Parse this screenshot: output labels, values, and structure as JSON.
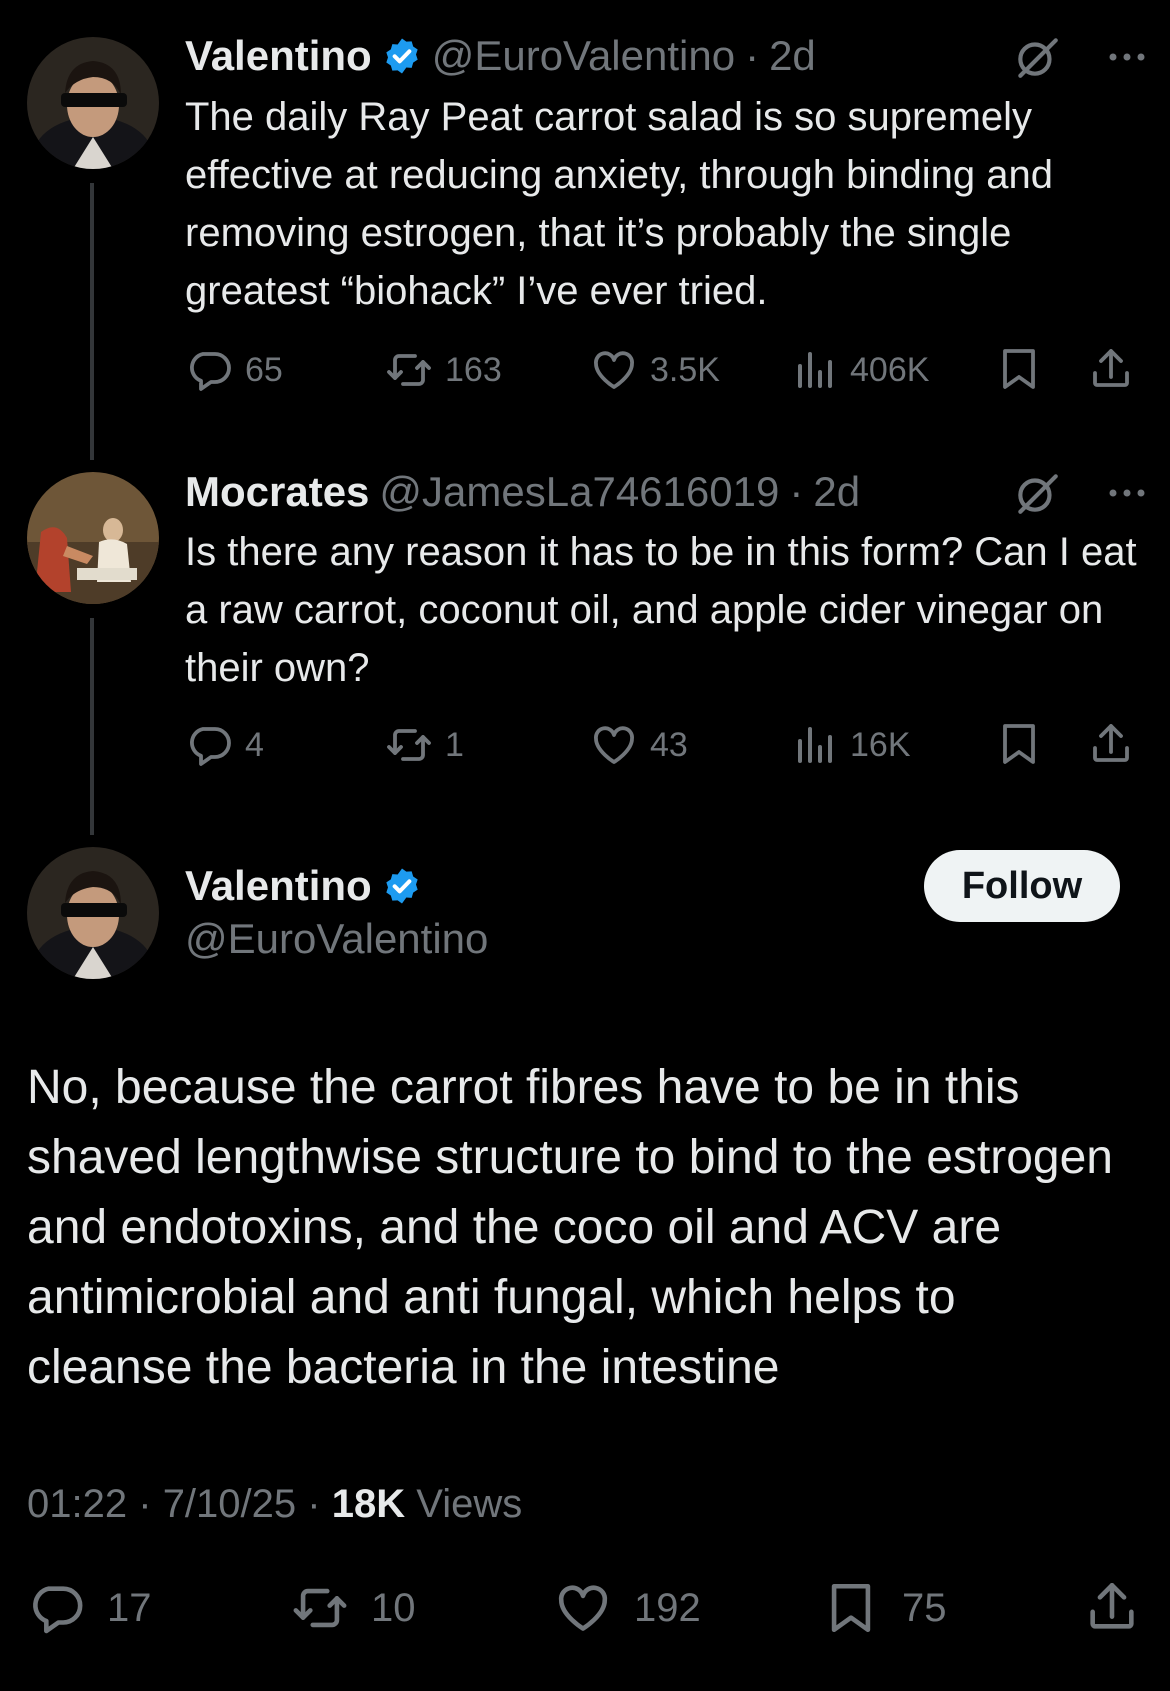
{
  "tweet1": {
    "name": "Valentino",
    "handle": "@EuroValentino",
    "dot": "·",
    "time": "2d",
    "text": "The daily Ray Peat carrot salad is so supremely effective at reducing anxiety, through binding and removing estrogen, that it’s probably the single greatest “biohack” I’ve ever tried.",
    "replies": "65",
    "reposts": "163",
    "likes": "3.5K",
    "views": "406K"
  },
  "tweet2": {
    "name": "Mocrates",
    "handle": "@JamesLa74616019",
    "dot": "·",
    "time": "2d",
    "text": "Is there any reason it has to be in this form? Can I eat a raw carrot, coconut oil, and apple cider vinegar on their own?",
    "replies": "4",
    "reposts": "1",
    "likes": "43",
    "views": "16K"
  },
  "main": {
    "name": "Valentino",
    "handle": "@EuroValentino",
    "follow_label": "Follow",
    "text": "No, because the carrot fibres have to be in this shaved lengthwise structure to bind to the estrogen and endotoxins, and the coco oil and ACV are antimicrobial and anti fungal, which helps to cleanse the bacteria in the intestine",
    "time": "01:22",
    "sep1": "·",
    "date": "7/10/25",
    "sep2": "·",
    "views_count": "18K",
    "views_label": "Views",
    "replies": "17",
    "reposts": "10",
    "likes": "192",
    "bookmarks": "75"
  },
  "icons": {
    "verified": "verified-badge-icon",
    "grok": "slash-circle-icon",
    "more": "more-icon",
    "reply": "reply-icon",
    "repost": "repost-icon",
    "like": "heart-icon",
    "views": "views-chart-icon",
    "bookmark": "bookmark-icon",
    "share": "share-icon"
  },
  "colors": {
    "background": "#000000",
    "text": "#e7e9ea",
    "muted": "#71767b",
    "verified": "#1d9bf0",
    "follow_bg": "#eff3f4"
  }
}
